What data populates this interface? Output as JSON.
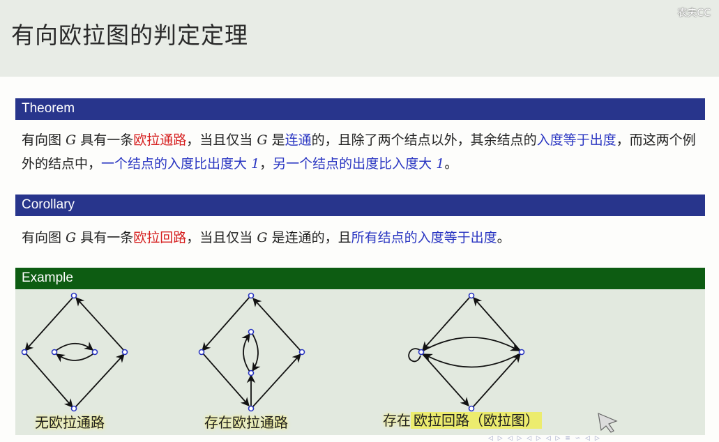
{
  "watermark": "农夫CC",
  "slide": {
    "title": "有向欧拉图的判定定理"
  },
  "theorem": {
    "heading": "Theorem",
    "t1": "有向图 ",
    "g1": "G",
    "t2": " 具有一条",
    "red1": "欧拉通路",
    "t3": "，当且仅当 ",
    "g2": "G",
    "t4": " 是",
    "blue1": "连通",
    "t5": "的，且除了两个结点以外，其余结点的",
    "blue2": "入度等于出度",
    "t6": "，而这两个例外的结点中，",
    "blue3": "一个结点的入度比出度大 ",
    "one1": "1",
    "t7": "，",
    "blue4": "另一个结点的出度比入度大 ",
    "one2": "1",
    "t8": "。"
  },
  "corollary": {
    "heading": "Corollary",
    "t1": "有向图 ",
    "g1": "G",
    "t2": " 具有一条",
    "red1": "欧拉回路",
    "t3": "，当且仅当 ",
    "g2": "G",
    "t4": " 是连通的，且",
    "blue1": "所有结点的入度等于出度",
    "t5": "。"
  },
  "example": {
    "heading": "Example",
    "caption1": "无欧拉通路",
    "caption2_a": "存在",
    "caption2_b": "欧拉通路",
    "caption3_a": "存在",
    "caption3_b": "欧拉回路（欧拉图）"
  },
  "colors": {
    "blue_header": "#28358c",
    "green_header": "#0d5c12",
    "highlight_red": "#d62020",
    "highlight_blue": "#2a36c2",
    "node_color": "#2a36c2",
    "marker_yellow": "#ecec6e"
  },
  "icons": [
    "cursor-arrow-icon",
    "beamer-navigation-icons"
  ]
}
